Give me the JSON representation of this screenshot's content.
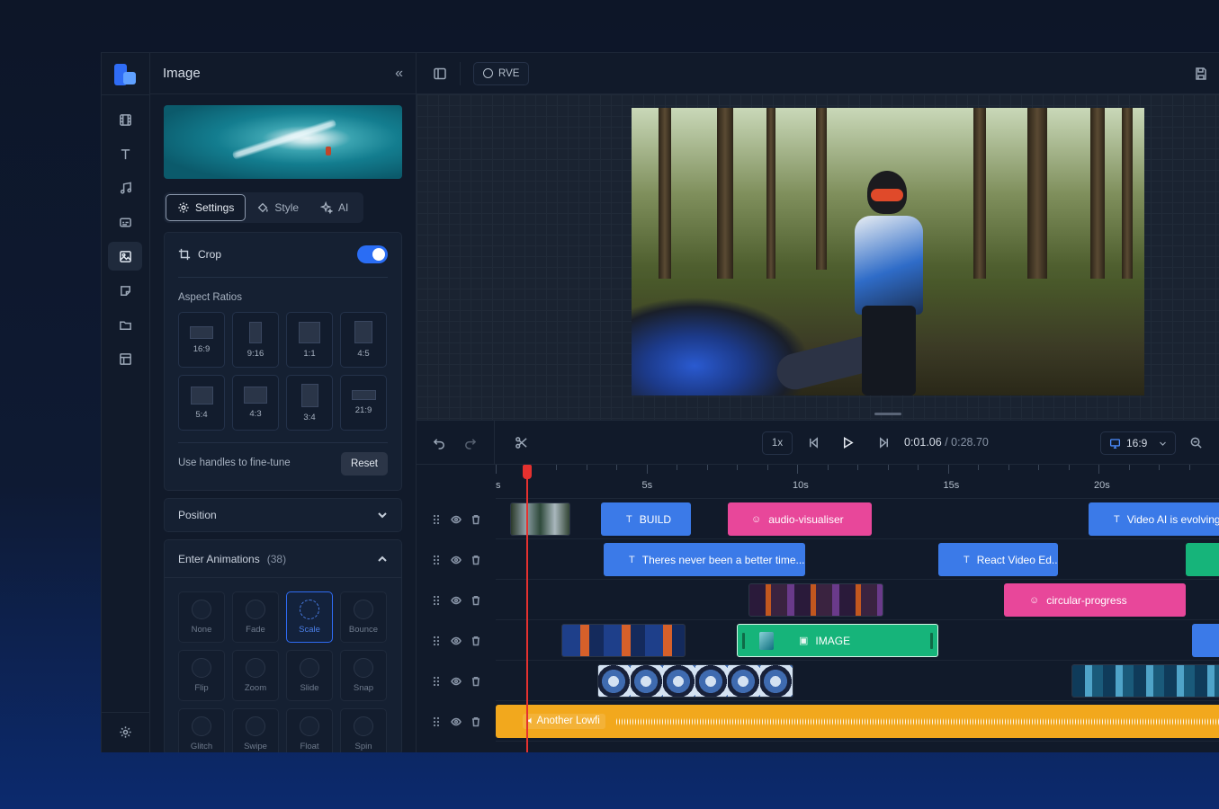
{
  "panel": {
    "title": "Image",
    "tabs": [
      {
        "label": "Settings",
        "icon": "gear-icon",
        "active": true
      },
      {
        "label": "Style",
        "icon": "paint-bucket-icon"
      },
      {
        "label": "AI",
        "icon": "sparkles-icon"
      }
    ],
    "crop": {
      "label": "Crop",
      "enabled": true
    },
    "aspect_ratios_label": "Aspect Ratios",
    "aspect_ratios": [
      "16:9",
      "9:16",
      "1:1",
      "4:5",
      "5:4",
      "4:3",
      "3:4",
      "21:9"
    ],
    "fine_tune_text": "Use handles to fine-tune",
    "reset_label": "Reset",
    "position_label": "Position",
    "enter_animations_label": "Enter Animations",
    "enter_animations_count": "(38)",
    "animations": [
      "None",
      "Fade",
      "Scale",
      "Bounce",
      "Flip",
      "Zoom",
      "Slide",
      "Snap",
      "Glitch",
      "Swipe",
      "Float",
      "Spin"
    ],
    "selected_animation": "Scale"
  },
  "topbar": {
    "project_label": "RVE"
  },
  "controls": {
    "speed": "1x",
    "current_time": "0:01.06",
    "separator": "/",
    "total_time": "0:28.70",
    "aspect": "16:9"
  },
  "timeline": {
    "ruler_labels": [
      "s",
      "5s",
      "10s",
      "15s",
      "20s"
    ],
    "clips": {
      "build": "BUILD",
      "audio_visualiser": "audio-visualiser",
      "video_ai": "Video AI is evolving",
      "theres_never": "Theres never been a better time...",
      "react_video": "React Video Ed...",
      "circular_progress": "circular-progress",
      "image": "IMAGE",
      "audio": "Another Lowfi"
    }
  },
  "colors": {
    "accent": "#2f6cf5",
    "text_clip": "#3b7ae8",
    "pink_clip": "#e8479a",
    "green_clip": "#16b47a",
    "audio_clip": "#f2a81d",
    "playhead": "#e5312f"
  }
}
